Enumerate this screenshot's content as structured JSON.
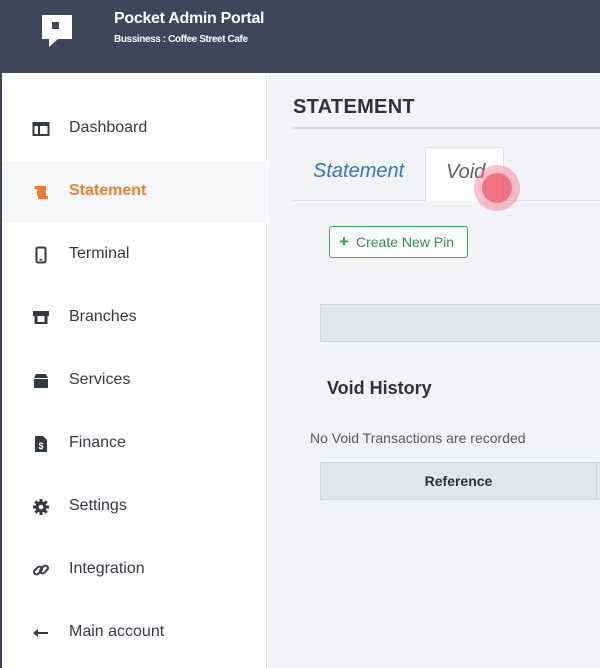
{
  "header": {
    "app_title": "Pocket Admin Portal",
    "business": "Bussiness : Coffee Street Cafe",
    "logo_icon": "pocket-logo-icon",
    "bg_color": "#3d4759"
  },
  "sidebar": {
    "items": [
      {
        "label": "Dashboard",
        "icon": "dashboard-icon",
        "active": false
      },
      {
        "label": "Statement",
        "icon": "statement-scroll-icon",
        "active": true
      },
      {
        "label": "Terminal",
        "icon": "mobile-device-icon",
        "active": false
      },
      {
        "label": "Branches",
        "icon": "store-icon",
        "active": false
      },
      {
        "label": "Services",
        "icon": "box-icon",
        "active": false
      },
      {
        "label": "Finance",
        "icon": "invoice-dollar-icon",
        "active": false
      },
      {
        "label": "Settings",
        "icon": "gear-icon",
        "active": false
      },
      {
        "label": "Integration",
        "icon": "link-icon",
        "active": false
      },
      {
        "label": "Main account",
        "icon": "arrow-left-icon",
        "active": false
      }
    ],
    "active_color": "#ef7d2d"
  },
  "main": {
    "page_title": "STATEMENT",
    "tabs": [
      {
        "label": "Statement",
        "active": false
      },
      {
        "label": "Void",
        "active": true
      }
    ],
    "create_button_label": "Create New Pin",
    "void_history_title": "Void History",
    "empty_message": "No Void Transactions are recorded",
    "table_headers": [
      "Reference"
    ]
  }
}
